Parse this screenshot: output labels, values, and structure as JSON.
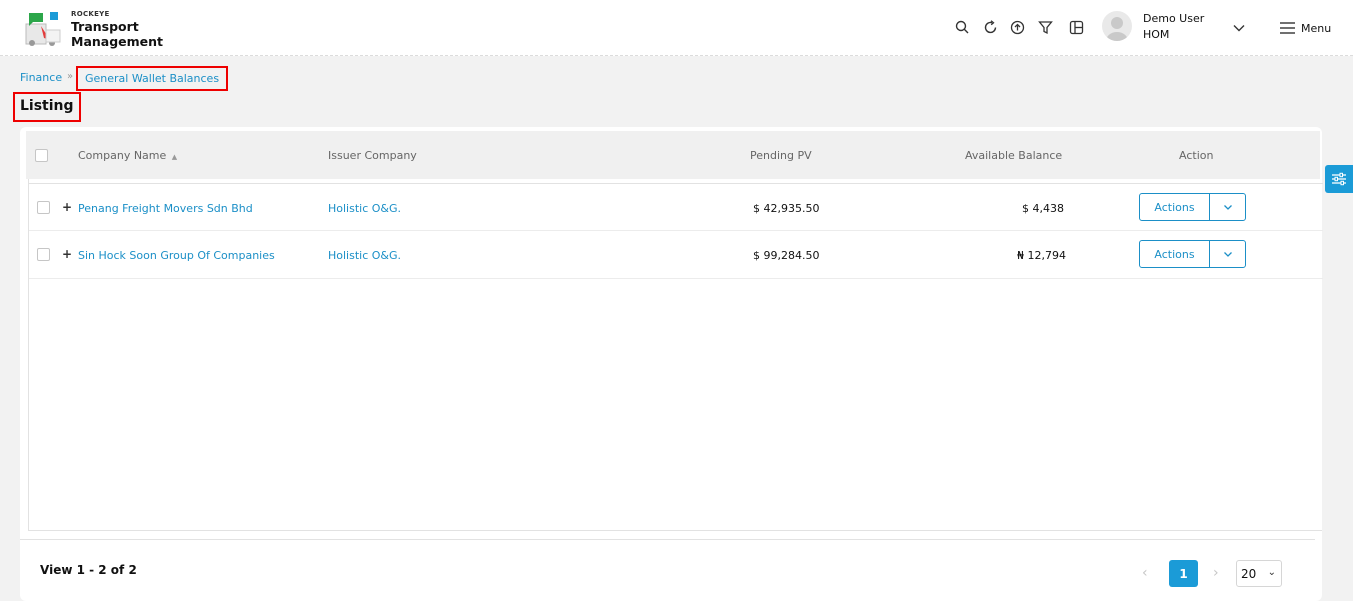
{
  "app": {
    "brand_small": "ROCKEYE",
    "brand_line1": "Transport",
    "brand_line2": "Management"
  },
  "header": {
    "icons": [
      "search-icon",
      "refresh-icon",
      "upload-icon",
      "filter-icon",
      "layout-icon"
    ],
    "user_name": "Demo User",
    "user_org": "HOM",
    "menu_label": "Menu"
  },
  "breadcrumb": {
    "root": "Finance",
    "current": "General Wallet Balances"
  },
  "page_title": "Listing",
  "table": {
    "columns": {
      "company": "Company Name",
      "issuer": "Issuer Company",
      "pending": "Pending PV",
      "available": "Available Balance",
      "action": "Action"
    },
    "rows": [
      {
        "company": "Penang Freight Movers Sdn Bhd",
        "issuer": "Holistic O&G.",
        "pending": "$ 42,935.50",
        "available": "$ 4,438",
        "action_label": "Actions"
      },
      {
        "company": "Sin Hock Soon Group Of Companies",
        "issuer": "Holistic O&G.",
        "pending": "$ 99,284.50",
        "available": "₦ 12,794",
        "action_label": "Actions"
      }
    ]
  },
  "footer": {
    "view_count": "View 1 - 2 of 2",
    "current_page": "1",
    "page_size": "20"
  },
  "colors": {
    "accent": "#1b9bd7",
    "link": "#1b8fc7",
    "highlight": "#ee0000"
  }
}
